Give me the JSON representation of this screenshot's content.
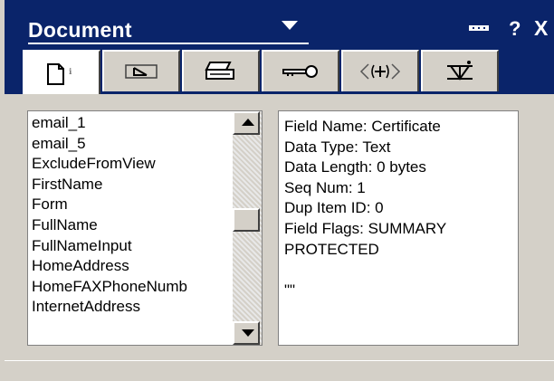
{
  "title": "Document",
  "controls": {
    "help": "?",
    "close": "X"
  },
  "tabs": [
    {
      "icon": "document-icon",
      "active": true
    },
    {
      "icon": "field-icon",
      "active": false
    },
    {
      "icon": "printer-icon",
      "active": false
    },
    {
      "icon": "key-icon",
      "active": false
    },
    {
      "icon": "html-tags-icon",
      "active": false
    },
    {
      "icon": "section-icon",
      "active": false
    }
  ],
  "fields_list": {
    "items": [
      "email_1",
      "email_5",
      "ExcludeFromView",
      "FirstName",
      "Form",
      "FullName",
      "FullNameInput",
      "HomeAddress",
      "HomeFAXPhoneNumb",
      "InternetAddress"
    ],
    "scroll_position": 0.45
  },
  "field_info": {
    "lines": [
      "Field Name: Certificate",
      "Data Type: Text",
      "Data Length: 0 bytes",
      "Seq Num: 1",
      "Dup Item ID: 0",
      "Field Flags: SUMMARY",
      "PROTECTED",
      "",
      "\"\""
    ]
  },
  "colors": {
    "title_bar": "#0a246a",
    "panel": "#d4d0c8"
  }
}
